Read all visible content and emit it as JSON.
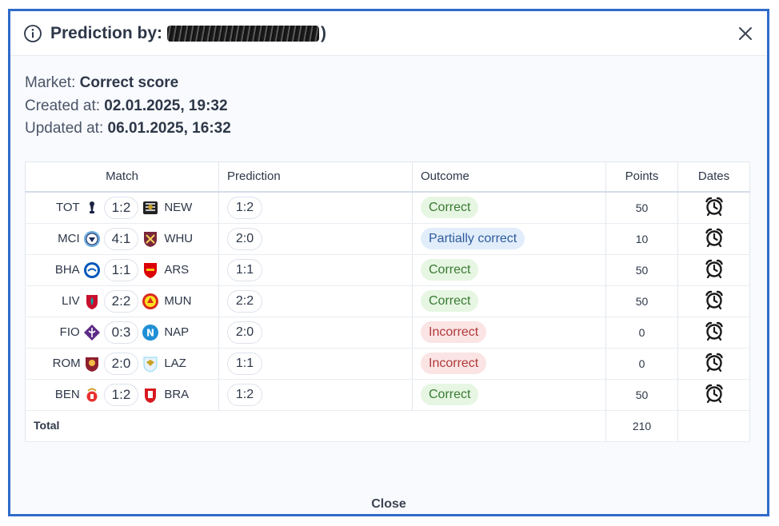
{
  "header": {
    "title_prefix": "Prediction by:",
    "title_suffix": ")"
  },
  "meta": {
    "market_label": "Market:",
    "market_value": "Correct score",
    "created_label": "Created at:",
    "created_value": "02.01.2025, 19:32",
    "updated_label": "Updated at:",
    "updated_value": "06.01.2025, 16:32"
  },
  "table": {
    "headers": [
      "Match",
      "Prediction",
      "Outcome",
      "Points",
      "Dates"
    ],
    "rows": [
      {
        "home": "TOT",
        "home_crest": "tottenham-crest",
        "score": "1:2",
        "away": "NEW",
        "away_crest": "newcastle-crest",
        "prediction": "1:2",
        "outcome": "Correct",
        "status": "correct",
        "points": "50"
      },
      {
        "home": "MCI",
        "home_crest": "man-city-crest",
        "score": "4:1",
        "away": "WHU",
        "away_crest": "west-ham-crest",
        "prediction": "2:0",
        "outcome": "Partially correct",
        "status": "partial",
        "points": "10"
      },
      {
        "home": "BHA",
        "home_crest": "brighton-crest",
        "score": "1:1",
        "away": "ARS",
        "away_crest": "arsenal-crest",
        "prediction": "1:1",
        "outcome": "Correct",
        "status": "correct",
        "points": "50"
      },
      {
        "home": "LIV",
        "home_crest": "liverpool-crest",
        "score": "2:2",
        "away": "MUN",
        "away_crest": "man-united-crest",
        "prediction": "2:2",
        "outcome": "Correct",
        "status": "correct",
        "points": "50"
      },
      {
        "home": "FIO",
        "home_crest": "fiorentina-crest",
        "score": "0:3",
        "away": "NAP",
        "away_crest": "napoli-crest",
        "prediction": "2:0",
        "outcome": "Incorrect",
        "status": "incorrect",
        "points": "0"
      },
      {
        "home": "ROM",
        "home_crest": "roma-crest",
        "score": "2:0",
        "away": "LAZ",
        "away_crest": "lazio-crest",
        "prediction": "1:1",
        "outcome": "Incorrect",
        "status": "incorrect",
        "points": "0"
      },
      {
        "home": "BEN",
        "home_crest": "benfica-crest",
        "score": "1:2",
        "away": "BRA",
        "away_crest": "braga-crest",
        "prediction": "1:2",
        "outcome": "Correct",
        "status": "correct",
        "points": "50"
      }
    ],
    "total_label": "Total",
    "total_points": "210"
  },
  "footer": {
    "close_label": "Close"
  },
  "icons": {
    "info": "info-circle-icon",
    "close": "close-icon",
    "dates": "alarm-clock-icon"
  },
  "colors": {
    "frame_border": "#2f6bc9",
    "correct_bg": "#e6f6e2",
    "partial_bg": "#e2edfb",
    "incorrect_bg": "#fbe4e4"
  }
}
